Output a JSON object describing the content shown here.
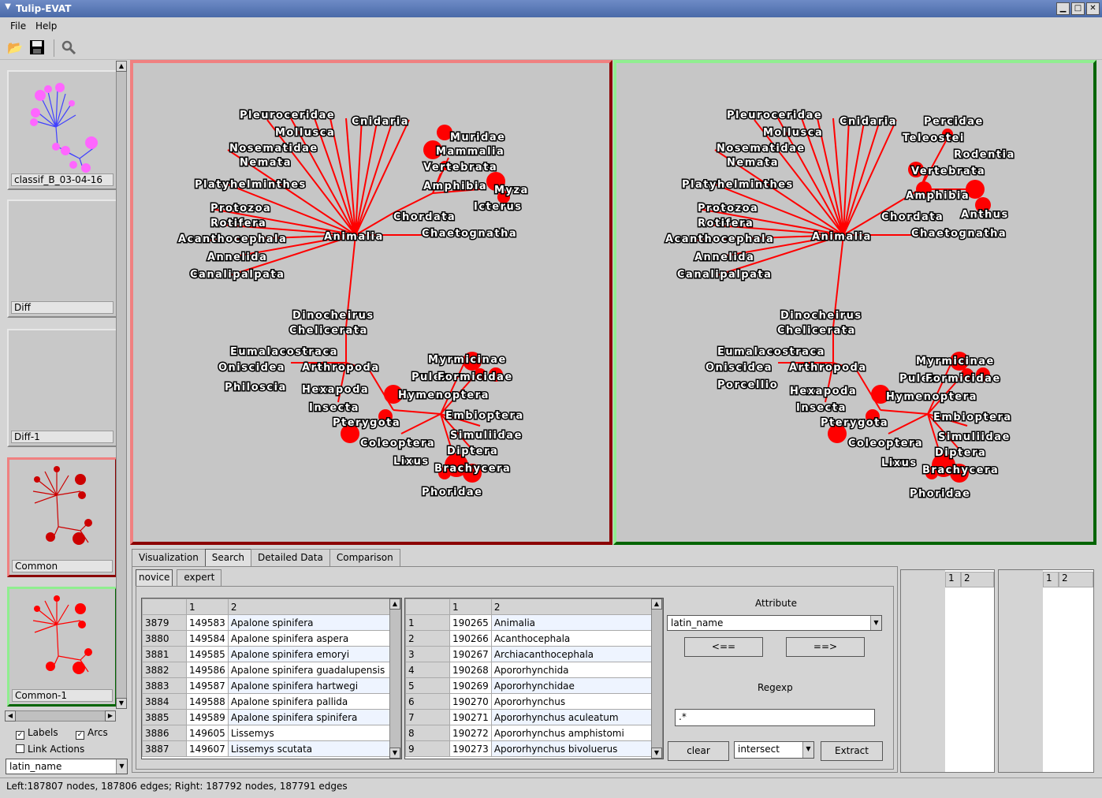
{
  "window": {
    "title": "Tulip-EVAT"
  },
  "menu": {
    "file": "File",
    "help": "Help"
  },
  "thumbnails": [
    {
      "label": "classif_B_03-04-16"
    },
    {
      "label": "Diff"
    },
    {
      "label": "Diff-1"
    },
    {
      "label": "Common",
      "border": "#e06060"
    },
    {
      "label": "Common-1",
      "border": "#60d060"
    }
  ],
  "left_options": {
    "labels": "Labels",
    "arcs": "Arcs",
    "link_actions": "Link Actions",
    "attribute": "latin_name"
  },
  "views": {
    "left": {
      "border_color": "#f08080",
      "border_bottom": "#8b0000",
      "labels": [
        "Pleuroceridae",
        "Cnidaria",
        "Mollusca",
        "Nosematidae",
        "Nemata",
        "Platyhelminthes",
        "Protozoa",
        "Rotifera",
        "Acanthocephala",
        "Annelida",
        "Canalipalpata",
        "Animalia",
        "Chordata",
        "Chaetognatha",
        "Muridae",
        "Mammalia",
        "Vertebrata",
        "Amphibia",
        "Myza",
        "Icterus",
        "Dinocheirus",
        "Chelicerata",
        "Eumalacostraca",
        "Oniscidea",
        "Arthropoda",
        "Philoscia",
        "Hexapoda",
        "Insecta",
        "Pterygota",
        "Coleoptera",
        "Lixus",
        "Pulex",
        "Formicidae",
        "Myrmicinae",
        "Hymenoptera",
        "Embioptera",
        "Simuliidae",
        "Diptera",
        "Brachycera",
        "Phoridae"
      ]
    },
    "right": {
      "border_color": "#90ee90",
      "border_bottom": "#006400",
      "labels": [
        "Pleuroceridae",
        "Cnidaria",
        "Mollusca",
        "Nosematidae",
        "Nemata",
        "Platyhelminthes",
        "Protozoa",
        "Rotifera",
        "Acanthocephala",
        "Annelida",
        "Canalipalpata",
        "Animalia",
        "Chordata",
        "Chaetognatha",
        "Percidae",
        "Teleostei",
        "Rodentia",
        "Vertebrata",
        "Amphibia",
        "Anthus",
        "Dinocheirus",
        "Chelicerata",
        "Eumalacostraca",
        "Oniscidea",
        "Arthropoda",
        "Porcellio",
        "Hexapoda",
        "Insecta",
        "Pterygota",
        "Coleoptera",
        "Lixus",
        "Pulex",
        "Formicidae",
        "Myrmicinae",
        "Hymenoptera",
        "Embioptera",
        "Simuliidae",
        "Diptera",
        "Brachycera",
        "Phoridae"
      ]
    }
  },
  "tabs": [
    "Visualization",
    "Search",
    "Detailed Data",
    "Comparison"
  ],
  "subtabs": [
    "novice",
    "expert"
  ],
  "table_left": {
    "headers": [
      "",
      "1",
      "2"
    ],
    "rows": [
      [
        "3879",
        "149583",
        "Apalone spinifera"
      ],
      [
        "3880",
        "149584",
        "Apalone spinifera aspera"
      ],
      [
        "3881",
        "149585",
        "Apalone spinifera emoryi"
      ],
      [
        "3882",
        "149586",
        "Apalone spinifera guadalupensis"
      ],
      [
        "3883",
        "149587",
        "Apalone spinifera hartwegi"
      ],
      [
        "3884",
        "149588",
        "Apalone spinifera pallida"
      ],
      [
        "3885",
        "149589",
        "Apalone spinifera spinifera"
      ],
      [
        "3886",
        "149605",
        "Lissemys"
      ],
      [
        "3887",
        "149607",
        "Lissemys scutata"
      ]
    ]
  },
  "table_right": {
    "headers": [
      "",
      "1",
      "2"
    ],
    "rows": [
      [
        "1",
        "190265",
        "Animalia"
      ],
      [
        "2",
        "190266",
        "Acanthocephala"
      ],
      [
        "3",
        "190267",
        "Archiacanthocephala"
      ],
      [
        "4",
        "190268",
        "Apororhynchida"
      ],
      [
        "5",
        "190269",
        "Apororhynchidae"
      ],
      [
        "6",
        "190270",
        "Apororhynchus"
      ],
      [
        "7",
        "190271",
        "Apororhynchus aculeatum"
      ],
      [
        "8",
        "190272",
        "Apororhynchus amphistomi"
      ],
      [
        "9",
        "190273",
        "Apororhynchus bivoluerus"
      ]
    ]
  },
  "search": {
    "attribute_label": "Attribute",
    "attribute_value": "latin_name",
    "left_btn": "<==",
    "right_btn": "==>",
    "regexp_label": "Regexp",
    "regexp_value": ".*",
    "clear": "clear",
    "mode": "intersect",
    "extract": "Extract"
  },
  "mini_tables": {
    "headers": [
      "1",
      "2"
    ]
  },
  "status": "Left:187807 nodes, 187806 edges; Right: 187792 nodes, 187791 edges"
}
